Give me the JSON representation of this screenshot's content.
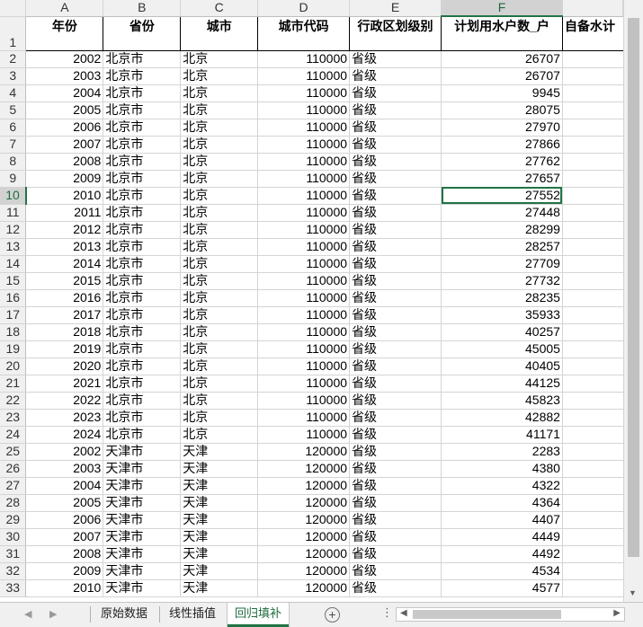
{
  "columns": [
    "A",
    "B",
    "C",
    "D",
    "E",
    "F"
  ],
  "selected_column": "F",
  "headers": [
    "年份",
    "省份",
    "城市",
    "城市代码",
    "行政区划级别",
    "计划用水户数_户",
    "自备水计"
  ],
  "selected_row": 10,
  "rows": [
    {
      "r": 2,
      "year": 2002,
      "prov": "北京市",
      "city": "北京",
      "code": 110000,
      "level": "省级",
      "val": 26707
    },
    {
      "r": 3,
      "year": 2003,
      "prov": "北京市",
      "city": "北京",
      "code": 110000,
      "level": "省级",
      "val": 26707
    },
    {
      "r": 4,
      "year": 2004,
      "prov": "北京市",
      "city": "北京",
      "code": 110000,
      "level": "省级",
      "val": 9945
    },
    {
      "r": 5,
      "year": 2005,
      "prov": "北京市",
      "city": "北京",
      "code": 110000,
      "level": "省级",
      "val": 28075
    },
    {
      "r": 6,
      "year": 2006,
      "prov": "北京市",
      "city": "北京",
      "code": 110000,
      "level": "省级",
      "val": 27970
    },
    {
      "r": 7,
      "year": 2007,
      "prov": "北京市",
      "city": "北京",
      "code": 110000,
      "level": "省级",
      "val": 27866
    },
    {
      "r": 8,
      "year": 2008,
      "prov": "北京市",
      "city": "北京",
      "code": 110000,
      "level": "省级",
      "val": 27762
    },
    {
      "r": 9,
      "year": 2009,
      "prov": "北京市",
      "city": "北京",
      "code": 110000,
      "level": "省级",
      "val": 27657
    },
    {
      "r": 10,
      "year": 2010,
      "prov": "北京市",
      "city": "北京",
      "code": 110000,
      "level": "省级",
      "val": 27552
    },
    {
      "r": 11,
      "year": 2011,
      "prov": "北京市",
      "city": "北京",
      "code": 110000,
      "level": "省级",
      "val": 27448
    },
    {
      "r": 12,
      "year": 2012,
      "prov": "北京市",
      "city": "北京",
      "code": 110000,
      "level": "省级",
      "val": 28299
    },
    {
      "r": 13,
      "year": 2013,
      "prov": "北京市",
      "city": "北京",
      "code": 110000,
      "level": "省级",
      "val": 28257
    },
    {
      "r": 14,
      "year": 2014,
      "prov": "北京市",
      "city": "北京",
      "code": 110000,
      "level": "省级",
      "val": 27709
    },
    {
      "r": 15,
      "year": 2015,
      "prov": "北京市",
      "city": "北京",
      "code": 110000,
      "level": "省级",
      "val": 27732
    },
    {
      "r": 16,
      "year": 2016,
      "prov": "北京市",
      "city": "北京",
      "code": 110000,
      "level": "省级",
      "val": 28235
    },
    {
      "r": 17,
      "year": 2017,
      "prov": "北京市",
      "city": "北京",
      "code": 110000,
      "level": "省级",
      "val": 35933
    },
    {
      "r": 18,
      "year": 2018,
      "prov": "北京市",
      "city": "北京",
      "code": 110000,
      "level": "省级",
      "val": 40257
    },
    {
      "r": 19,
      "year": 2019,
      "prov": "北京市",
      "city": "北京",
      "code": 110000,
      "level": "省级",
      "val": 45005
    },
    {
      "r": 20,
      "year": 2020,
      "prov": "北京市",
      "city": "北京",
      "code": 110000,
      "level": "省级",
      "val": 40405
    },
    {
      "r": 21,
      "year": 2021,
      "prov": "北京市",
      "city": "北京",
      "code": 110000,
      "level": "省级",
      "val": 44125
    },
    {
      "r": 22,
      "year": 2022,
      "prov": "北京市",
      "city": "北京",
      "code": 110000,
      "level": "省级",
      "val": 45823
    },
    {
      "r": 23,
      "year": 2023,
      "prov": "北京市",
      "city": "北京",
      "code": 110000,
      "level": "省级",
      "val": 42882
    },
    {
      "r": 24,
      "year": 2024,
      "prov": "北京市",
      "city": "北京",
      "code": 110000,
      "level": "省级",
      "val": 41171
    },
    {
      "r": 25,
      "year": 2002,
      "prov": "天津市",
      "city": "天津",
      "code": 120000,
      "level": "省级",
      "val": 2283
    },
    {
      "r": 26,
      "year": 2003,
      "prov": "天津市",
      "city": "天津",
      "code": 120000,
      "level": "省级",
      "val": 4380
    },
    {
      "r": 27,
      "year": 2004,
      "prov": "天津市",
      "city": "天津",
      "code": 120000,
      "level": "省级",
      "val": 4322
    },
    {
      "r": 28,
      "year": 2005,
      "prov": "天津市",
      "city": "天津",
      "code": 120000,
      "level": "省级",
      "val": 4364
    },
    {
      "r": 29,
      "year": 2006,
      "prov": "天津市",
      "city": "天津",
      "code": 120000,
      "level": "省级",
      "val": 4407
    },
    {
      "r": 30,
      "year": 2007,
      "prov": "天津市",
      "city": "天津",
      "code": 120000,
      "level": "省级",
      "val": 4449
    },
    {
      "r": 31,
      "year": 2008,
      "prov": "天津市",
      "city": "天津",
      "code": 120000,
      "level": "省级",
      "val": 4492
    },
    {
      "r": 32,
      "year": 2009,
      "prov": "天津市",
      "city": "天津",
      "code": 120000,
      "level": "省级",
      "val": 4534
    },
    {
      "r": 33,
      "year": 2010,
      "prov": "天津市",
      "city": "天津",
      "code": 120000,
      "level": "省级",
      "val": 4577
    }
  ],
  "tabs": [
    "原始数据",
    "线性插值",
    "回归填补"
  ],
  "active_tab": 2,
  "icons": {
    "nav_prev": "◀",
    "nav_next": "▶",
    "add_sheet": "+",
    "ellipsis": "⋮",
    "scroll_left": "◀",
    "scroll_right": "▶",
    "scroll_down": "▼"
  },
  "colors": {
    "accent": "#217346"
  }
}
